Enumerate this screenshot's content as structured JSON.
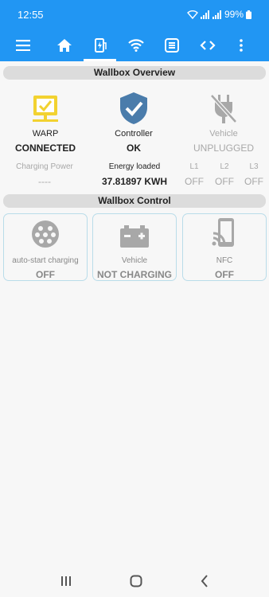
{
  "status_bar": {
    "time": "12:55",
    "battery": "99%"
  },
  "nav": {
    "tabs": [
      "menu",
      "home",
      "charger",
      "wifi",
      "ethernet",
      "code"
    ],
    "active_tab": "charger"
  },
  "overview": {
    "header": "Wallbox Overview",
    "items": [
      {
        "label": "WARP",
        "value": "CONNECTED",
        "icon": "warp-monitor-icon",
        "color": "#f2d230"
      },
      {
        "label": "Controller",
        "value": "OK",
        "icon": "shield-check-icon",
        "color": "#4a7cab"
      },
      {
        "label": "Vehicle",
        "value": "UNPLUGGED",
        "icon": "unplugged-icon",
        "color": "#a8a8a8"
      }
    ],
    "metrics": {
      "charging_power": {
        "label": "Charging Power",
        "value": "----"
      },
      "energy_loaded": {
        "label": "Energy loaded",
        "value": "37.81897 KWH"
      },
      "l1": {
        "label": "L1",
        "value": "OFF"
      },
      "l2": {
        "label": "L2",
        "value": "OFF"
      },
      "l3": {
        "label": "L3",
        "value": "OFF"
      }
    }
  },
  "control": {
    "header": "Wallbox Control",
    "cards": [
      {
        "label": "auto-start charging",
        "value": "OFF",
        "icon": "connector-icon"
      },
      {
        "label": "Vehicle",
        "value": "NOT CHARGING",
        "icon": "battery-icon"
      },
      {
        "label": "NFC",
        "value": "OFF",
        "icon": "nfc-icon"
      }
    ]
  },
  "colors": {
    "primary": "#2196f3",
    "warp": "#f2d230",
    "controller": "#4a7cab",
    "muted": "#a8a8a8",
    "card_border": "#b9dce9"
  }
}
